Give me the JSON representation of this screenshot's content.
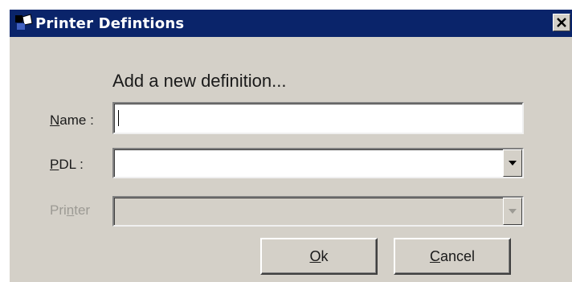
{
  "window": {
    "title": "Printer Defintions"
  },
  "form": {
    "heading": "Add a new definition...",
    "name": {
      "mnemonic": "N",
      "label_rest": "ame :",
      "value": ""
    },
    "pdl": {
      "mnemonic": "P",
      "label_rest": "DL :",
      "value": ""
    },
    "printer": {
      "label_pre": "Pri",
      "mnemonic": "n",
      "label_rest": "ter",
      "value": "",
      "enabled": false
    }
  },
  "buttons": {
    "ok": {
      "mnemonic": "O",
      "label_rest": "k"
    },
    "cancel": {
      "mnemonic": "C",
      "label_rest": "ancel"
    }
  },
  "colors": {
    "titlebar": "#0a246a",
    "face": "#d4d0c8",
    "disabled_text": "#9c9a94"
  },
  "icons": {
    "app": "printer-app-icon",
    "close": "close-icon",
    "dropdown": "chevron-down-icon"
  }
}
